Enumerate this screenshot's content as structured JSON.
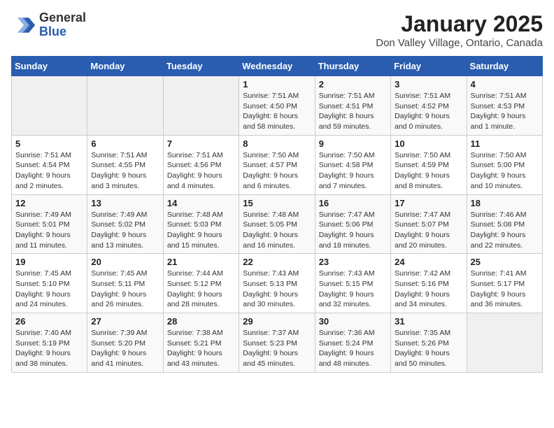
{
  "header": {
    "logo": {
      "line1": "General",
      "line2": "Blue"
    },
    "title": "January 2025",
    "subtitle": "Don Valley Village, Ontario, Canada"
  },
  "days_of_week": [
    "Sunday",
    "Monday",
    "Tuesday",
    "Wednesday",
    "Thursday",
    "Friday",
    "Saturday"
  ],
  "weeks": [
    [
      {
        "day": "",
        "info": ""
      },
      {
        "day": "",
        "info": ""
      },
      {
        "day": "",
        "info": ""
      },
      {
        "day": "1",
        "info": "Sunrise: 7:51 AM\nSunset: 4:50 PM\nDaylight: 8 hours and 58 minutes."
      },
      {
        "day": "2",
        "info": "Sunrise: 7:51 AM\nSunset: 4:51 PM\nDaylight: 8 hours and 59 minutes."
      },
      {
        "day": "3",
        "info": "Sunrise: 7:51 AM\nSunset: 4:52 PM\nDaylight: 9 hours and 0 minutes."
      },
      {
        "day": "4",
        "info": "Sunrise: 7:51 AM\nSunset: 4:53 PM\nDaylight: 9 hours and 1 minute."
      }
    ],
    [
      {
        "day": "5",
        "info": "Sunrise: 7:51 AM\nSunset: 4:54 PM\nDaylight: 9 hours and 2 minutes."
      },
      {
        "day": "6",
        "info": "Sunrise: 7:51 AM\nSunset: 4:55 PM\nDaylight: 9 hours and 3 minutes."
      },
      {
        "day": "7",
        "info": "Sunrise: 7:51 AM\nSunset: 4:56 PM\nDaylight: 9 hours and 4 minutes."
      },
      {
        "day": "8",
        "info": "Sunrise: 7:50 AM\nSunset: 4:57 PM\nDaylight: 9 hours and 6 minutes."
      },
      {
        "day": "9",
        "info": "Sunrise: 7:50 AM\nSunset: 4:58 PM\nDaylight: 9 hours and 7 minutes."
      },
      {
        "day": "10",
        "info": "Sunrise: 7:50 AM\nSunset: 4:59 PM\nDaylight: 9 hours and 8 minutes."
      },
      {
        "day": "11",
        "info": "Sunrise: 7:50 AM\nSunset: 5:00 PM\nDaylight: 9 hours and 10 minutes."
      }
    ],
    [
      {
        "day": "12",
        "info": "Sunrise: 7:49 AM\nSunset: 5:01 PM\nDaylight: 9 hours and 11 minutes."
      },
      {
        "day": "13",
        "info": "Sunrise: 7:49 AM\nSunset: 5:02 PM\nDaylight: 9 hours and 13 minutes."
      },
      {
        "day": "14",
        "info": "Sunrise: 7:48 AM\nSunset: 5:03 PM\nDaylight: 9 hours and 15 minutes."
      },
      {
        "day": "15",
        "info": "Sunrise: 7:48 AM\nSunset: 5:05 PM\nDaylight: 9 hours and 16 minutes."
      },
      {
        "day": "16",
        "info": "Sunrise: 7:47 AM\nSunset: 5:06 PM\nDaylight: 9 hours and 18 minutes."
      },
      {
        "day": "17",
        "info": "Sunrise: 7:47 AM\nSunset: 5:07 PM\nDaylight: 9 hours and 20 minutes."
      },
      {
        "day": "18",
        "info": "Sunrise: 7:46 AM\nSunset: 5:08 PM\nDaylight: 9 hours and 22 minutes."
      }
    ],
    [
      {
        "day": "19",
        "info": "Sunrise: 7:45 AM\nSunset: 5:10 PM\nDaylight: 9 hours and 24 minutes."
      },
      {
        "day": "20",
        "info": "Sunrise: 7:45 AM\nSunset: 5:11 PM\nDaylight: 9 hours and 26 minutes."
      },
      {
        "day": "21",
        "info": "Sunrise: 7:44 AM\nSunset: 5:12 PM\nDaylight: 9 hours and 28 minutes."
      },
      {
        "day": "22",
        "info": "Sunrise: 7:43 AM\nSunset: 5:13 PM\nDaylight: 9 hours and 30 minutes."
      },
      {
        "day": "23",
        "info": "Sunrise: 7:43 AM\nSunset: 5:15 PM\nDaylight: 9 hours and 32 minutes."
      },
      {
        "day": "24",
        "info": "Sunrise: 7:42 AM\nSunset: 5:16 PM\nDaylight: 9 hours and 34 minutes."
      },
      {
        "day": "25",
        "info": "Sunrise: 7:41 AM\nSunset: 5:17 PM\nDaylight: 9 hours and 36 minutes."
      }
    ],
    [
      {
        "day": "26",
        "info": "Sunrise: 7:40 AM\nSunset: 5:19 PM\nDaylight: 9 hours and 38 minutes."
      },
      {
        "day": "27",
        "info": "Sunrise: 7:39 AM\nSunset: 5:20 PM\nDaylight: 9 hours and 41 minutes."
      },
      {
        "day": "28",
        "info": "Sunrise: 7:38 AM\nSunset: 5:21 PM\nDaylight: 9 hours and 43 minutes."
      },
      {
        "day": "29",
        "info": "Sunrise: 7:37 AM\nSunset: 5:23 PM\nDaylight: 9 hours and 45 minutes."
      },
      {
        "day": "30",
        "info": "Sunrise: 7:36 AM\nSunset: 5:24 PM\nDaylight: 9 hours and 48 minutes."
      },
      {
        "day": "31",
        "info": "Sunrise: 7:35 AM\nSunset: 5:26 PM\nDaylight: 9 hours and 50 minutes."
      },
      {
        "day": "",
        "info": ""
      }
    ]
  ]
}
